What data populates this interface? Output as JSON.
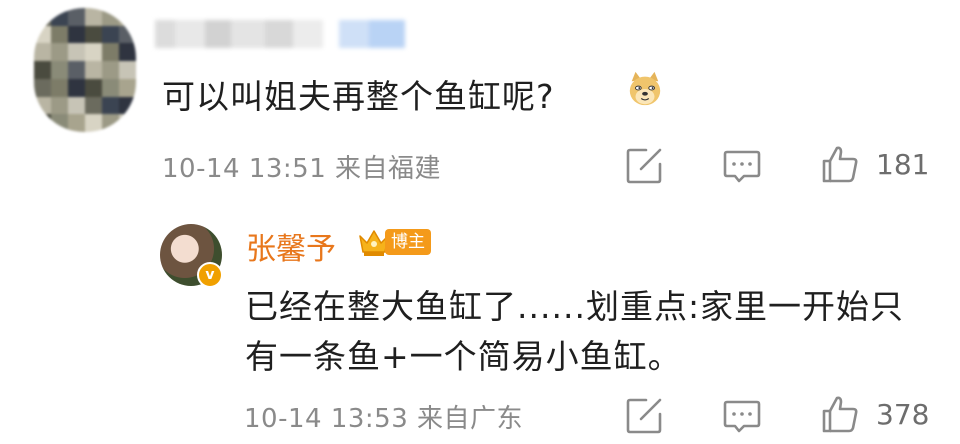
{
  "comment": {
    "text": "可以叫姐夫再整个鱼缸呢?",
    "emoji": "doge-emoji",
    "meta": "10-14 13:51 来自福建",
    "likes": "181"
  },
  "reply": {
    "username": "张馨予",
    "badge": "博主",
    "text": "已经在整大鱼缸了......划重点:家里一开始只有一条鱼+一个简易小鱼缸。",
    "meta": "10-14 13:53 来自广东",
    "likes": "378"
  },
  "icons": {
    "share": "share-icon",
    "comment": "comment-icon",
    "like": "like-icon"
  },
  "colors": {
    "username": "#e8771c",
    "badge": "#f49a1a",
    "meta": "#8a8a8a"
  }
}
